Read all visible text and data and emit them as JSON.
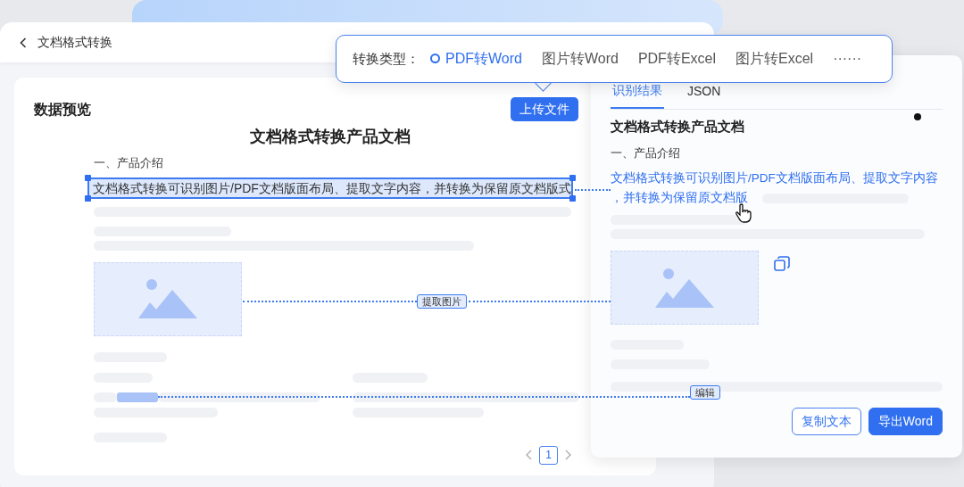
{
  "header": {
    "title": "文档格式转换"
  },
  "preview": {
    "title": "数据预览",
    "upload_button": "上传文件",
    "doc_title": "文档格式转换产品文档",
    "section": "一、产品介绍",
    "selected_line": "文档格式转换可识别图片/PDF文档版面布局、提取文字内容，并转换为保留原文档版式",
    "page": "1"
  },
  "conversion_popover": {
    "label": "转换类型：",
    "options": [
      {
        "label": "PDF转Word",
        "selected": true
      },
      {
        "label": "图片转Word",
        "selected": false
      },
      {
        "label": "PDF转Excel",
        "selected": false
      },
      {
        "label": "图片转Excel",
        "selected": false
      }
    ],
    "more": "······"
  },
  "result_panel": {
    "tabs": [
      {
        "label": "识别结果",
        "selected": true
      },
      {
        "label": "JSON",
        "selected": false
      }
    ],
    "doc_title": "文档格式转换产品文档",
    "section": "一、产品介绍",
    "recognized_text": [
      "文档格式转换可识别图片/PDF文档版面布局、提取文字内容",
      "，并转换为保留原文档版"
    ],
    "buttons": [
      {
        "label": "复制文本",
        "kind": "outline"
      },
      {
        "label": "导出Word",
        "kind": "primary"
      }
    ]
  },
  "connectors": [
    {
      "label": "提取图片"
    },
    {
      "label": "编辑"
    }
  ]
}
